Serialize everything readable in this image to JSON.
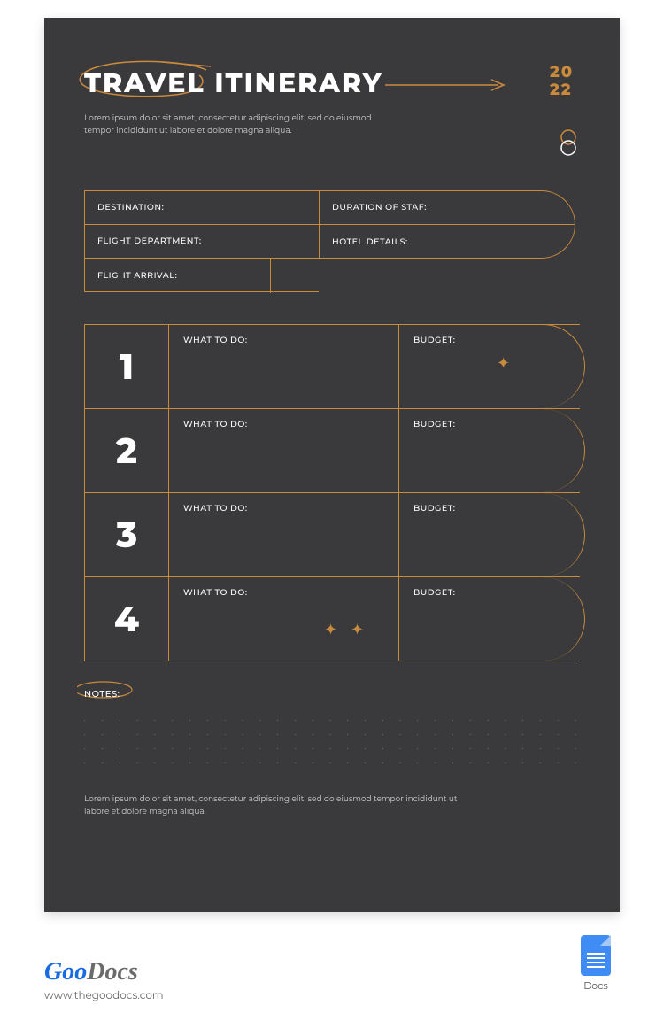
{
  "header": {
    "title": "TRAVEL ITINERARY",
    "year_line1": "20",
    "year_line2": "22",
    "intro": "Lorem ipsum dolor sit amet, consectetur adipiscing elit, sed do eiusmod tempor incididunt ut labore et dolore magna aliqua."
  },
  "info": {
    "destination_label": "DESTINATION:",
    "flight_department_label": "FLIGHT DEPARTMENT:",
    "flight_arrival_label": "FLIGHT ARRIVAL:",
    "duration_label": "DURATION OF STAF:",
    "hotel_label": "HOTEL DETAILS:"
  },
  "columns": {
    "what_to_do": "WHAT TO DO:",
    "budget": "BUDGET:"
  },
  "days": [
    {
      "num": "1"
    },
    {
      "num": "2"
    },
    {
      "num": "3"
    },
    {
      "num": "4"
    }
  ],
  "notes": {
    "label": "NOTES:"
  },
  "footer": {
    "text": "Lorem ipsum dolor sit amet, consectetur adipiscing elit, sed do eiusmod tempor incididunt ut labore et dolore magna aliqua."
  },
  "brand": {
    "goo": "Goo",
    "docs": "Docs",
    "url": "www.thegoodocs.com",
    "badge_label": "Docs"
  },
  "colors": {
    "accent": "#c98a3c",
    "bg": "#3a3a3d"
  }
}
